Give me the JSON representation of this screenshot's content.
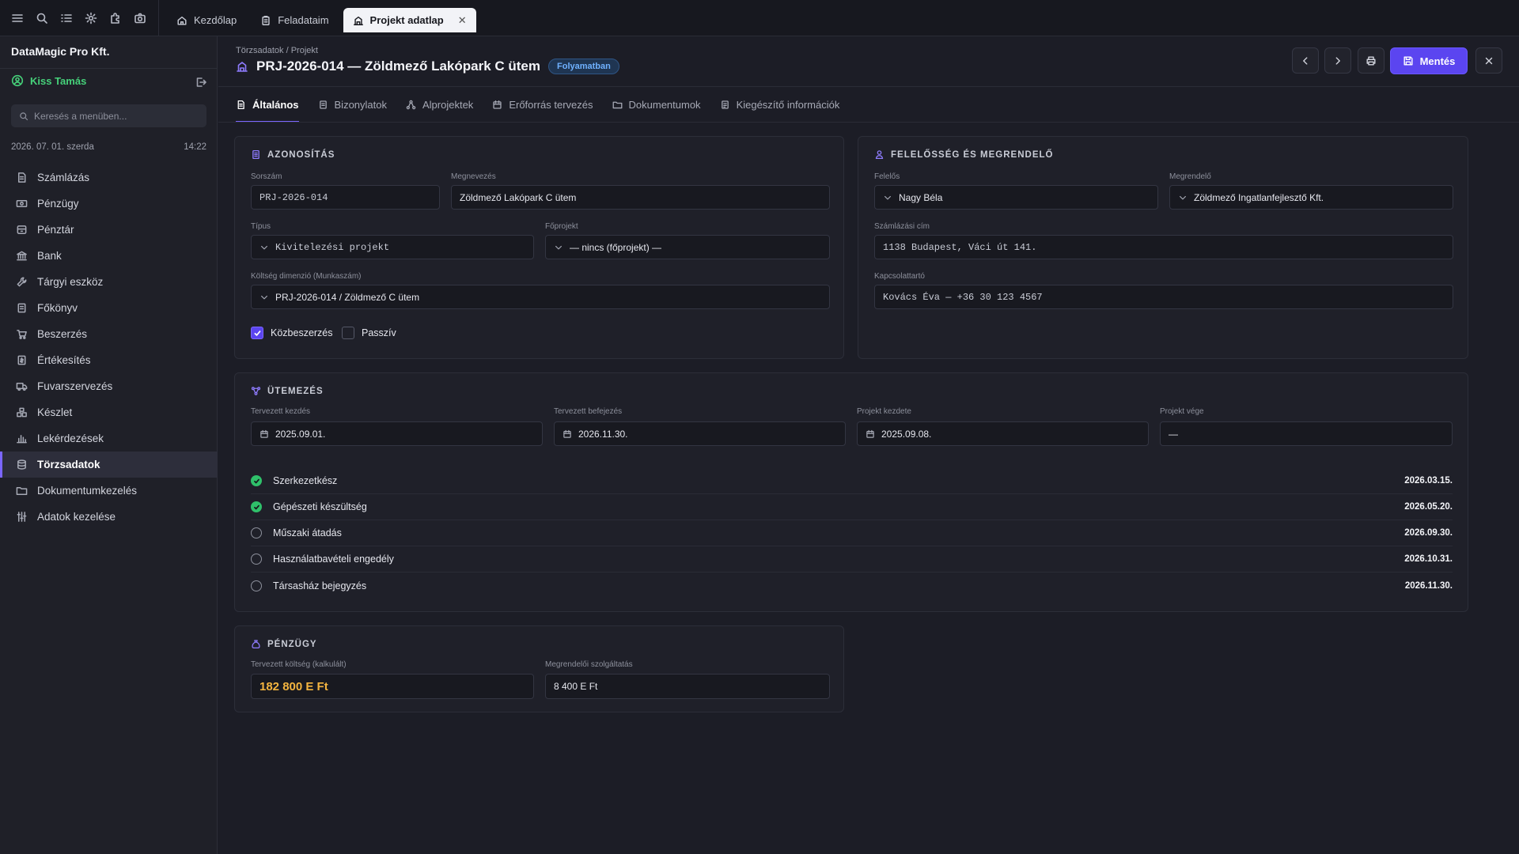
{
  "tabs": [
    {
      "label": "Kezdőlap",
      "icon": "home-icon"
    },
    {
      "label": "Feladataim",
      "icon": "clipboard-icon"
    },
    {
      "label": "Projekt adatlap",
      "icon": "building-icon",
      "active": true
    }
  ],
  "sidebar": {
    "company": "DataMagic Pro Kft.",
    "user": "Kiss Tamás",
    "search_placeholder": "Keresés a menüben...",
    "date": "2026. 07. 01. szerda",
    "time": "14:22",
    "items": [
      {
        "label": "Számlázás",
        "icon": "invoice-icon"
      },
      {
        "label": "Pénzügy",
        "icon": "money-icon"
      },
      {
        "label": "Pénztár",
        "icon": "cashbox-icon"
      },
      {
        "label": "Bank",
        "icon": "bank-icon"
      },
      {
        "label": "Tárgyi eszköz",
        "icon": "wrench-icon"
      },
      {
        "label": "Főkönyv",
        "icon": "ledger-icon"
      },
      {
        "label": "Beszerzés",
        "icon": "cart-icon"
      },
      {
        "label": "Értékesítés",
        "icon": "sales-icon"
      },
      {
        "label": "Fuvarszervezés",
        "icon": "truck-icon"
      },
      {
        "label": "Készlet",
        "icon": "boxes-icon"
      },
      {
        "label": "Lekérdezések",
        "icon": "chart-icon"
      },
      {
        "label": "Törzsadatok",
        "icon": "database-icon",
        "active": true
      },
      {
        "label": "Dokumentumkezelés",
        "icon": "folder-icon"
      },
      {
        "label": "Adatok kezelése",
        "icon": "sliders-icon"
      }
    ]
  },
  "header": {
    "breadcrumb": "Törzsadatok / Projekt",
    "title": "PRJ-2026-014 — Zöldmező Lakópark C ütem",
    "status": "Folyamatban",
    "save_label": "Mentés"
  },
  "content_tabs": [
    {
      "label": "Általános",
      "active": true
    },
    {
      "label": "Bizonylatok"
    },
    {
      "label": "Alprojektek"
    },
    {
      "label": "Erőforrás tervezés"
    },
    {
      "label": "Dokumentumok"
    },
    {
      "label": "Kiegészítő információk"
    }
  ],
  "identification": {
    "title": "AZONOSÍTÁS",
    "serial_label": "Sorszám",
    "serial_value": "PRJ-2026-014",
    "name_label": "Megnevezés",
    "name_value": "Zöldmező Lakópark C ütem",
    "type_label": "Típus",
    "type_value": "Kivitelezési projekt",
    "parent_label": "Főprojekt",
    "parent_value": "— nincs (főprojekt) —",
    "cost_label": "Költség dimenzió (Munkaszám)",
    "cost_value": "PRJ-2026-014 / Zöldmező C ütem",
    "public_label": "Közbeszerzés",
    "public_checked": true,
    "passive_label": "Passzív",
    "passive_checked": false
  },
  "responsibility": {
    "title": "FELELŐSSÉG ÉS MEGRENDELŐ",
    "owner_label": "Felelős",
    "owner_value": "Nagy Béla",
    "client_label": "Megrendelő",
    "client_value": "Zöldmező Ingatlanfejlesztő Kft.",
    "billing_label": "Számlázási cím",
    "billing_value": "1138 Budapest, Váci út 141.",
    "contact_label": "Kapcsolattartó",
    "contact_value": "Kovács Éva — +36 30 123 4567"
  },
  "schedule": {
    "title": "ÜTEMEZÉS",
    "planned_start_label": "Tervezett kezdés",
    "planned_start": "2025.09.01.",
    "planned_end_label": "Tervezett befejezés",
    "planned_end": "2026.11.30.",
    "start_label": "Projekt kezdete",
    "start": "2025.09.08.",
    "end_label": "Projekt vége",
    "end": "—",
    "milestones": [
      {
        "name": "Szerkezetkész",
        "date": "2026.03.15.",
        "done": true
      },
      {
        "name": "Gépészeti készültség",
        "date": "2026.05.20.",
        "done": true
      },
      {
        "name": "Műszaki átadás",
        "date": "2026.09.30.",
        "done": false
      },
      {
        "name": "Használatbavételi engedély",
        "date": "2026.10.31.",
        "done": false
      },
      {
        "name": "Társasház bejegyzés",
        "date": "2026.11.30.",
        "done": false
      }
    ]
  },
  "finance": {
    "title": "PÉNZÜGY",
    "planned_cost_label": "Tervezett költség (kalkulált)",
    "planned_cost": "182 800 E Ft",
    "client_service_label": "Megrendelői szolgáltatás",
    "client_service": "8 400 E Ft"
  },
  "colors": {
    "accent": "#5b45f0",
    "success": "#2fc06a",
    "money": "#f3b43f",
    "status": "#6fb1ff"
  }
}
